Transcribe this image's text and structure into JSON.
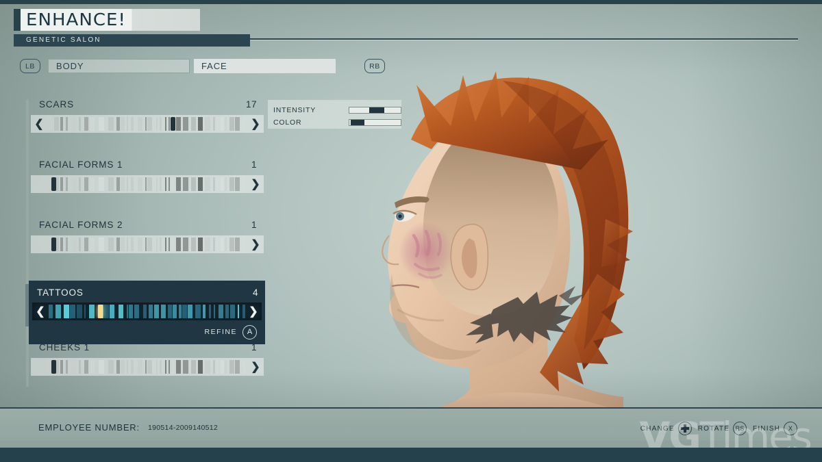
{
  "header": {
    "logo": "ENHANCE!",
    "subtitle": "GENETIC SALON"
  },
  "tabs": {
    "left_bumper": "LB",
    "right_bumper": "RB",
    "items": [
      {
        "label": "BODY",
        "active": false
      },
      {
        "label": "FACE",
        "active": true
      }
    ]
  },
  "options": [
    {
      "name": "SCARS",
      "value": "17",
      "selected": false,
      "has_left_arrow": true,
      "marker": 0.6
    },
    {
      "name": "FACIAL FORMS 1",
      "value": "1",
      "selected": false,
      "has_left_arrow": false,
      "marker": 0.02
    },
    {
      "name": "FACIAL FORMS 2",
      "value": "1",
      "selected": false,
      "has_left_arrow": false,
      "marker": 0.02
    },
    {
      "name": "TATTOOS",
      "value": "4",
      "selected": true,
      "has_left_arrow": true,
      "marker": 0.24,
      "refine_label": "REFINE",
      "refine_button": "A"
    },
    {
      "name": "CHEEKS 1",
      "value": "1",
      "selected": false,
      "has_left_arrow": false,
      "marker": 0.02
    }
  ],
  "adjustments": {
    "rows": [
      {
        "label": "INTENSITY",
        "fill_percent": 55,
        "knob_percent": 38
      },
      {
        "label": "COLOR",
        "fill_percent": 22,
        "knob_percent": 2
      }
    ]
  },
  "footer": {
    "employee_label": "EMPLOYEE NUMBER:",
    "employee_number": "190514-2009140512",
    "hints": [
      {
        "label": "CHANGE",
        "glyph": "dpad-icon",
        "glyph_text": ""
      },
      {
        "label": "ROTATE",
        "glyph": "stick-icon",
        "glyph_text": "RS"
      },
      {
        "label": "FINISH",
        "glyph": "x-icon",
        "glyph_text": "X"
      }
    ],
    "watermark": "VGTimes"
  },
  "colors": {
    "accent_dark": "#28424c",
    "panel_light": "#dde3e0",
    "selected_row": "#203743",
    "tattoo_marker": "#f6d98a",
    "hair": "#b4521f"
  }
}
